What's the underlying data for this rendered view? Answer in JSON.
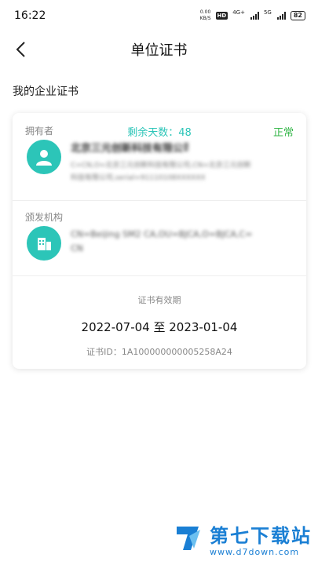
{
  "status_bar": {
    "time": "16:22",
    "net_speed_value": "0.00",
    "net_speed_unit": "KB/S",
    "hd_badge": "HD",
    "network_1": "4G+",
    "network_2": "5G",
    "battery": "82"
  },
  "nav": {
    "title": "单位证书"
  },
  "section": {
    "title": "我的企业证书"
  },
  "certificate": {
    "owner_label": "拥有者",
    "remaining_days": "剩余天数：48",
    "status": "正常",
    "owner_name": "北京三元创新科技有限公司",
    "owner_dn_line1": "C=CN,O=北京三元创新科技有限公司,CN=北京三元创新",
    "owner_dn_line2": "科技有限公司,serial=91110108XXXXXX",
    "issuer_label": "颁发机构",
    "issuer_line1": "CN=Beijing SM2 CA,OU=BJCA,O=BJCA,C=",
    "issuer_line2": "CN",
    "validity_label": "证书有效期",
    "validity_range": "2022-07-04 至 2023-01-04",
    "cert_id": "证书ID：1A100000000005258A24"
  },
  "watermark": {
    "title": "第七下载站",
    "url": "www.d7down.com"
  },
  "colors": {
    "accent": "#2cc5b8",
    "status_ok": "#36b74a",
    "watermark": "#1a7fd4"
  }
}
